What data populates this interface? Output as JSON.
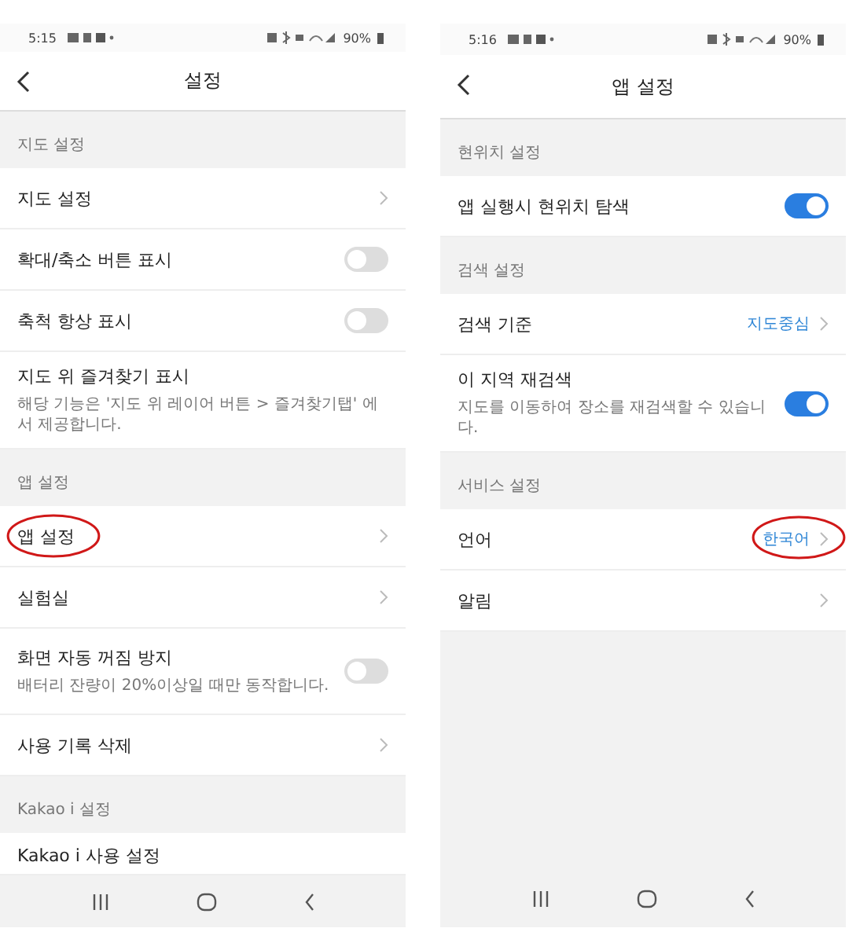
{
  "screens": [
    {
      "status_bar": {
        "time": "5:15",
        "battery": "90%"
      },
      "title": "설정",
      "sections": [
        {
          "label": "지도 설정",
          "items": [
            {
              "kind": "chevron",
              "label": "지도 설정",
              "annotated": false
            },
            {
              "kind": "toggle",
              "label": "확대/축소 버튼 표시",
              "on": false
            },
            {
              "kind": "toggle",
              "label": "축척 항상 표시",
              "on": false
            },
            {
              "kind": "plain",
              "label": "지도 위 즐겨찾기 표시",
              "description": "해당 기능은 '지도 위 레이어 버튼 > 즐겨찾기탭' 에서 제공합니다."
            }
          ]
        },
        {
          "label": "앱 설정",
          "items": [
            {
              "kind": "chevron",
              "label": "앱 설정",
              "annotated": true
            },
            {
              "kind": "chevron",
              "label": "실험실",
              "annotated": false
            },
            {
              "kind": "toggle",
              "label": "화면 자동 꺼짐 방지",
              "description": "배터리 잔량이 20%이상일 때만 동작합니다.",
              "on": false
            },
            {
              "kind": "chevron",
              "label": "사용 기록 삭제",
              "annotated": false
            }
          ]
        },
        {
          "label": "Kakao i 설정",
          "items": [
            {
              "kind": "cut",
              "label": "Kakao i 사용 설정"
            }
          ]
        }
      ]
    },
    {
      "status_bar": {
        "time": "5:16",
        "battery": "90%"
      },
      "title": "앱 설정",
      "sections": [
        {
          "label": "현위치 설정",
          "items": [
            {
              "kind": "toggle",
              "label": "앱 실행시 현위치 탐색",
              "on": true
            }
          ]
        },
        {
          "label": "검색 설정",
          "items": [
            {
              "kind": "value",
              "label": "검색 기준",
              "value": "지도중심",
              "annotated": false
            },
            {
              "kind": "toggle",
              "label": "이 지역 재검색",
              "description": "지도를 이동하여 장소를 재검색할 수 있습니다.",
              "on": true
            }
          ]
        },
        {
          "label": "서비스 설정",
          "items": [
            {
              "kind": "value",
              "label": "언어",
              "value": "한국어",
              "annotated": true
            },
            {
              "kind": "chevron",
              "label": "알림",
              "annotated": false
            }
          ]
        }
      ]
    }
  ]
}
